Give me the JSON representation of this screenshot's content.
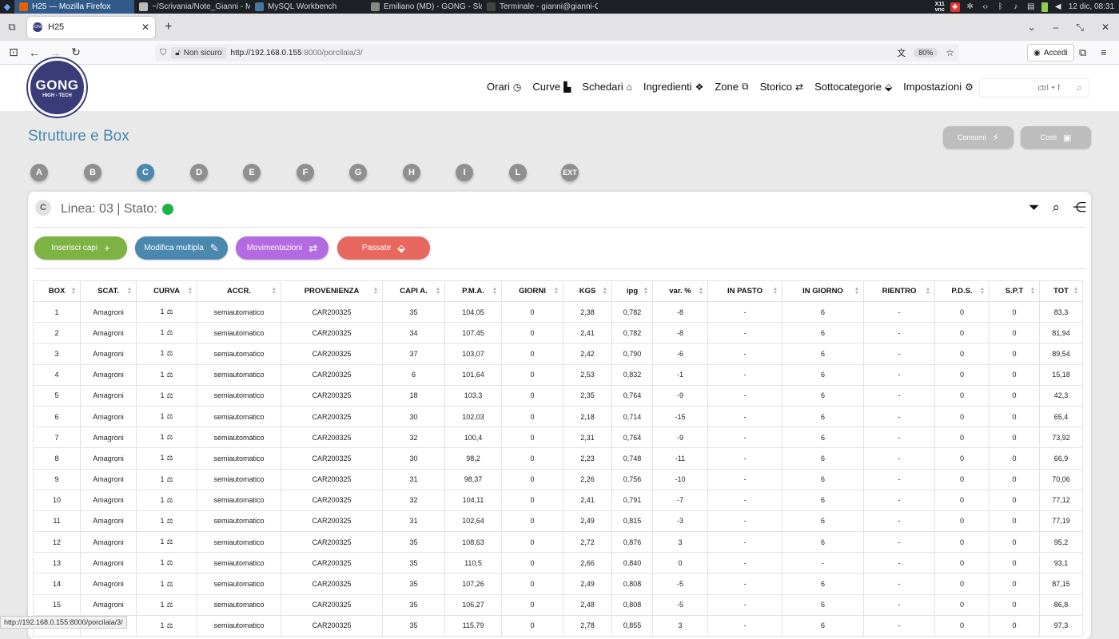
{
  "os": {
    "tasks": [
      {
        "label": "H25 — Mozilla Firefox",
        "color": "#e66000",
        "active": true
      },
      {
        "label": "~/Scrivania/Note_Gianni - M...",
        "color": "#bbbbbb",
        "active": false
      },
      {
        "label": "MySQL Workbench",
        "color": "#4479a1",
        "active": false
      },
      {
        "label": "Emiliano (MD) - GONG - Slack",
        "color": "#888888",
        "active": false
      },
      {
        "label": "Terminale - gianni@gianni-O...",
        "color": "#444444",
        "active": false
      }
    ],
    "tray_x11": [
      "X11",
      "vnc"
    ],
    "clock": "12 dic, 08:31"
  },
  "browser": {
    "tab_title": "H25",
    "security_label": "Non sicuro",
    "url_host": "http://192.168.0.155",
    "url_path": ":8000/porcilaia/3/",
    "zoom": "80%",
    "signin_label": "Accedi",
    "status_url": "http://192.168.0.155:8000/porcilaia/3/"
  },
  "app": {
    "logo_main": "GONG",
    "logo_sub": "HIGH - TECH",
    "menu": [
      {
        "label": "Orari",
        "icon": "clock-icon",
        "glyph": "◷"
      },
      {
        "label": "Curve",
        "icon": "chart-icon",
        "glyph": "▙"
      },
      {
        "label": "Schedari",
        "icon": "warehouse-icon",
        "glyph": "⌂"
      },
      {
        "label": "Ingredienti",
        "icon": "cubes-icon",
        "glyph": "❖"
      },
      {
        "label": "Zone",
        "icon": "vector-square-icon",
        "glyph": "⧉"
      },
      {
        "label": "Storico",
        "icon": "exchange-icon",
        "glyph": "⇄"
      },
      {
        "label": "Sottocategorie",
        "icon": "tag-icon",
        "glyph": "⬙"
      },
      {
        "label": "Impostazioni",
        "icon": "gear-icon",
        "glyph": "⚙"
      }
    ],
    "search_placeholder": "ctrl + f"
  },
  "page": {
    "title": "Strutture e Box",
    "consumi_label": "Consumi",
    "costi_label": "Costi",
    "structures": [
      "A",
      "B",
      "C",
      "D",
      "E",
      "F",
      "G",
      "H",
      "I",
      "L",
      "EXT"
    ],
    "active_structure": "C",
    "card": {
      "badge": "C",
      "title": "Linea: 03 | Stato:",
      "status_color": "#1fb445",
      "actions": [
        {
          "label": "Inserisci capi",
          "glyph": "+",
          "color": "#7cb342"
        },
        {
          "label": "Modifica multipla",
          "glyph": "✎",
          "color": "#4a88b0"
        },
        {
          "label": "Movimentazioni",
          "glyph": "⇄",
          "color": "#b46ae0"
        },
        {
          "label": "Passate",
          "glyph": "⬙",
          "color": "#e8675f"
        }
      ]
    }
  },
  "table": {
    "columns": [
      "BOX",
      "SCAT.",
      "CURVA",
      "ACCR.",
      "PROVENIENZA",
      "CAPI A.",
      "P.M.A.",
      "GIORNI",
      "KGS",
      "ipg",
      "var. %",
      "IN PASTO",
      "IN GIORNO",
      "RIENTRO",
      "P.D.S.",
      "S.P.T",
      "TOT"
    ],
    "rows": [
      [
        "1",
        "Amagroni",
        "1",
        "semiautomatico",
        "CAR200325",
        "35",
        "104,05",
        "0",
        "2,38",
        "0,782",
        "-8",
        "-",
        "6",
        "-",
        "0",
        "0",
        "83,3"
      ],
      [
        "2",
        "Amagroni",
        "1",
        "semiautomatico",
        "CAR200325",
        "34",
        "107,45",
        "0",
        "2,41",
        "0,782",
        "-8",
        "-",
        "6",
        "-",
        "0",
        "0",
        "81,94"
      ],
      [
        "3",
        "Amagroni",
        "1",
        "semiautomatico",
        "CAR200325",
        "37",
        "103,07",
        "0",
        "2,42",
        "0,790",
        "-6",
        "-",
        "6",
        "-",
        "0",
        "0",
        "89,54"
      ],
      [
        "4",
        "Amagroni",
        "1",
        "semiautomatico",
        "CAR200325",
        "6",
        "101,64",
        "0",
        "2,53",
        "0,832",
        "-1",
        "-",
        "6",
        "-",
        "0",
        "0",
        "15,18"
      ],
      [
        "5",
        "Amagroni",
        "1",
        "semiautomatico",
        "CAR200325",
        "18",
        "103,3",
        "0",
        "2,35",
        "0,764",
        "-9",
        "-",
        "6",
        "-",
        "0",
        "0",
        "42,3"
      ],
      [
        "6",
        "Amagroni",
        "1",
        "semiautomatico",
        "CAR200325",
        "30",
        "102,03",
        "0",
        "2,18",
        "0,714",
        "-15",
        "-",
        "6",
        "-",
        "0",
        "0",
        "65,4"
      ],
      [
        "7",
        "Amagroni",
        "1",
        "semiautomatico",
        "CAR200325",
        "32",
        "100,4",
        "0",
        "2,31",
        "0,764",
        "-9",
        "-",
        "6",
        "-",
        "0",
        "0",
        "73,92"
      ],
      [
        "8",
        "Amagroni",
        "1",
        "semiautomatico",
        "CAR200325",
        "30",
        "98,2",
        "0",
        "2,23",
        "0,748",
        "-11",
        "-",
        "6",
        "-",
        "0",
        "0",
        "66,9"
      ],
      [
        "9",
        "Amagroni",
        "1",
        "semiautomatico",
        "CAR200325",
        "31",
        "98,37",
        "0",
        "2,26",
        "0,756",
        "-10",
        "-",
        "6",
        "-",
        "0",
        "0",
        "70,06"
      ],
      [
        "10",
        "Amagroni",
        "1",
        "semiautomatico",
        "CAR200325",
        "32",
        "104,11",
        "0",
        "2,41",
        "0,791",
        "-7",
        "-",
        "6",
        "-",
        "0",
        "0",
        "77,12"
      ],
      [
        "11",
        "Amagroni",
        "1",
        "semiautomatico",
        "CAR200325",
        "31",
        "102,64",
        "0",
        "2,49",
        "0,815",
        "-3",
        "-",
        "6",
        "-",
        "0",
        "0",
        "77,19"
      ],
      [
        "12",
        "Amagroni",
        "1",
        "semiautomatico",
        "CAR200325",
        "35",
        "108,63",
        "0",
        "2,72",
        "0,876",
        "3",
        "-",
        "6",
        "-",
        "0",
        "0",
        "95,2"
      ],
      [
        "13",
        "Amagroni",
        "1",
        "semiautomatico",
        "CAR200325",
        "35",
        "110,5",
        "0",
        "2,66",
        "0,840",
        "0",
        "-",
        "-",
        "-",
        "0",
        "0",
        "93,1"
      ],
      [
        "14",
        "Amagroni",
        "1",
        "semiautomatico",
        "CAR200325",
        "35",
        "107,26",
        "0",
        "2,49",
        "0,808",
        "-5",
        "-",
        "6",
        "-",
        "0",
        "0",
        "87,15"
      ],
      [
        "15",
        "Amagroni",
        "1",
        "semiautomatico",
        "CAR200325",
        "35",
        "106,27",
        "0",
        "2,48",
        "0,808",
        "-5",
        "-",
        "6",
        "-",
        "0",
        "0",
        "86,8"
      ],
      [
        "",
        "",
        "1",
        "semiautomatico",
        "CAR200325",
        "35",
        "115,79",
        "0",
        "2,78",
        "0,855",
        "3",
        "-",
        "6",
        "-",
        "0",
        "0",
        "97,3"
      ]
    ]
  }
}
